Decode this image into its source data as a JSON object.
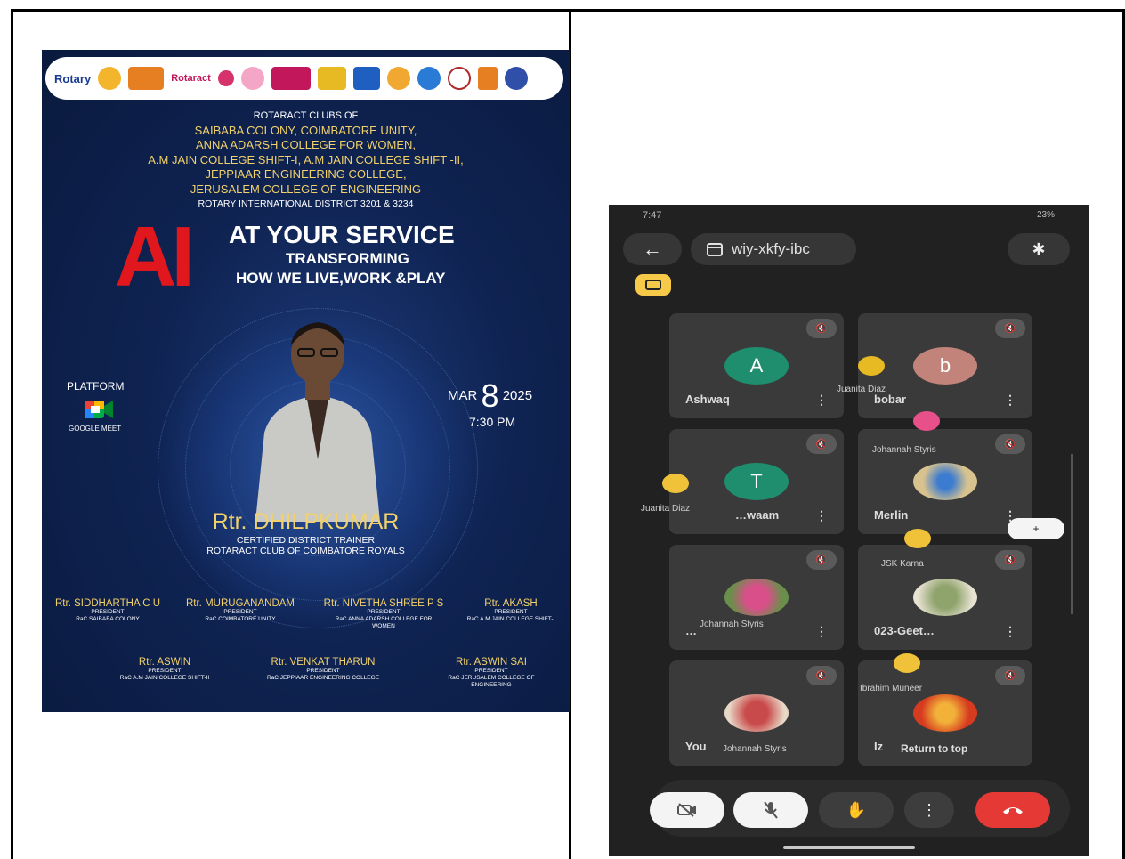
{
  "poster": {
    "logos": {
      "rotary": "Rotary",
      "rotaract": "Rotaract"
    },
    "clubs_heading": "ROTARACT CLUBS OF",
    "clubs_lines": [
      "SAIBABA COLONY, COIMBATORE UNITY,",
      "ANNA ADARSH COLLEGE FOR WOMEN,",
      "A.M JAIN COLLEGE SHIFT-I, A.M JAIN COLLEGE SHIFT -II,",
      "JEPPIAAR ENGINEERING COLLEGE,",
      "JERUSALEM COLLEGE OF ENGINEERING"
    ],
    "district": "ROTARY INTERNATIONAL DISTRICT 3201 & 3234",
    "title_ai": "AI",
    "title_rest": "AT YOUR SERVICE",
    "subtitle1": "TRANSFORMING",
    "subtitle2": "HOW WE LIVE,WORK &PLAY",
    "platform_label": "PLATFORM",
    "platform_name": "GOOGLE MEET",
    "date_month": "MAR",
    "date_day": "8",
    "date_year": "2025",
    "time": "7:30 PM",
    "speaker_name": "Rtr. DHILPKUMAR",
    "speaker_role1": "CERTIFIED DISTRICT TRAINER",
    "speaker_role2": "ROTARACT CLUB OF COIMBATORE ROYALS",
    "presidents": [
      {
        "name": "Rtr. SIDDHARTHA C U",
        "title": "PRESIDENT",
        "club": "RaC SAIBABA COLONY"
      },
      {
        "name": "Rtr. MURUGANANDAM",
        "title": "PRESIDENT",
        "club": "RaC COIMBATORE UNITY"
      },
      {
        "name": "Rtr. NIVETHA SHREE P S",
        "title": "PRESIDENT",
        "club": "RaC ANNA ADARSH COLLEGE FOR WOMEN"
      },
      {
        "name": "Rtr. AKASH",
        "title": "PRESIDENT",
        "club": "RaC A.M JAIN COLLEGE SHIFT-I"
      },
      {
        "name": "Rtr. ASWIN",
        "title": "PRESIDENT",
        "club": "RaC A.M JAIN COLLEGE SHIFT-II"
      },
      {
        "name": "Rtr. VENKAT THARUN",
        "title": "PRESIDENT",
        "club": "RaC JEPPIAAR ENGINEERING COLLEGE"
      },
      {
        "name": "Rtr. ASWIN SAI",
        "title": "PRESIDENT",
        "club": "RaC JERUSALEM COLLEGE OF ENGINEERING"
      }
    ]
  },
  "phone": {
    "status_time": "7:47",
    "status_right": "23%",
    "meeting_code": "wiy-xkfy-ibc",
    "back_icon": "←",
    "bluetooth_icon": "✱",
    "participants": [
      {
        "name": "Ashwaq",
        "initial": "A",
        "color": "#1e8e6e"
      },
      {
        "name": "bobar",
        "initial": "b",
        "color": "#c2847a"
      },
      {
        "name": "…waam",
        "initial": "T",
        "color": "#1e8e6e"
      },
      {
        "name": "Merlin",
        "initial": "",
        "color": "#d8c38f"
      },
      {
        "name": "…",
        "initial": "",
        "color": "#c85c8a"
      },
      {
        "name": "023-Geet…",
        "initial": "",
        "color": "#6e7f58"
      },
      {
        "name": "You",
        "initial": "",
        "color": "#b34a4a"
      },
      {
        "name": "Iz",
        "initial": "",
        "color": "#d63a1f"
      }
    ],
    "overlays": {
      "juanita_top": "Juanita Diaz",
      "johannah1": "Johannah Styris",
      "juanita_left": "Juanita Diaz",
      "jsk": "JSK Karna",
      "johannah2": "Johannah Styris",
      "ibrahim": "Ibrahim Muneer",
      "johannah3": "Johannah Styris",
      "return_top": "Return to top"
    },
    "side_control": "+"
  },
  "colors": {
    "poster_bg": "#0f2352",
    "accent_red": "#e1171e",
    "gold": "#f2d16b",
    "end_call": "#e53935"
  }
}
